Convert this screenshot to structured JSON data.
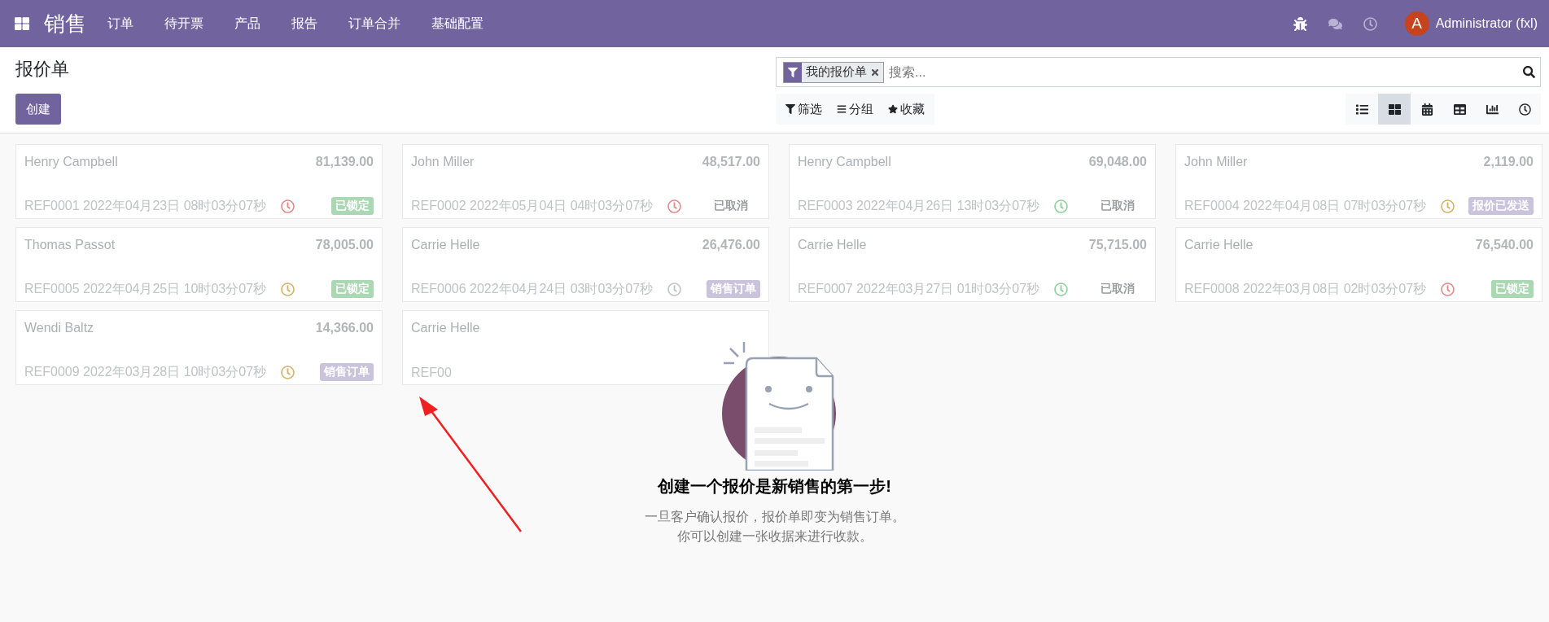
{
  "navbar": {
    "app_name": "销售",
    "menu": [
      "订单",
      "待开票",
      "产品",
      "报告",
      "订单合并",
      "基础配置"
    ],
    "user": {
      "initial": "A",
      "name": "Administrator (fxl)"
    }
  },
  "control_panel": {
    "title": "报价单",
    "create_button": "创建",
    "search": {
      "facet": "我的报价单",
      "placeholder": "搜索..."
    },
    "filters": [
      "筛选",
      "分组",
      "收藏"
    ],
    "views": [
      {
        "kind": "list",
        "selected": false
      },
      {
        "kind": "kanban",
        "selected": true
      },
      {
        "kind": "calendar",
        "selected": false
      },
      {
        "kind": "pivot",
        "selected": false
      },
      {
        "kind": "graph",
        "selected": false
      },
      {
        "kind": "activity",
        "selected": false
      }
    ]
  },
  "cards": [
    {
      "customer": "Henry Campbell",
      "amount": "81,139.00",
      "ref": "REF0001 2022年04月23日 08时03分07秒",
      "color": "#e08a8a",
      "status": {
        "label": "已锁定",
        "color": "#a9d8b3"
      }
    },
    {
      "customer": "John Miller",
      "amount": "48,517.00",
      "ref": "REF0002 2022年05月04日 04时03分07秒",
      "color": "#e08a8a",
      "status": {
        "label": "已取消"
      }
    },
    {
      "customer": "Henry Campbell",
      "amount": "69,048.00",
      "ref": "REF0003 2022年04月26日 13时03分07秒",
      "color": "#8fcf9c",
      "status": {
        "label": "已取消"
      }
    },
    {
      "customer": "John Miller",
      "amount": "2,119.00",
      "ref": "REF0004 2022年04月08日 07时03分07秒",
      "color": "#d4b26a",
      "status": {
        "label": "报价已发送",
        "color": "#c9c3dc"
      }
    },
    {
      "customer": "Thomas Passot",
      "amount": "78,005.00",
      "ref": "REF0005 2022年04月25日 10时03分07秒",
      "color": "#d4b26a",
      "status": {
        "label": "已锁定",
        "color": "#a9d8b3"
      }
    },
    {
      "customer": "Carrie Helle",
      "amount": "26,476.00",
      "ref": "REF0006 2022年04月24日 03时03分07秒",
      "color": "#c0c4c8",
      "status": {
        "label": "销售订单",
        "color": "#c9c3dc"
      }
    },
    {
      "customer": "Carrie Helle",
      "amount": "75,715.00",
      "ref": "REF0007 2022年03月27日 01时03分07秒",
      "color": "#8fcf9c",
      "status": {
        "label": "已取消"
      }
    },
    {
      "customer": "Carrie Helle",
      "amount": "76,540.00",
      "ref": "REF0008 2022年03月08日 02时03分07秒",
      "color": "#e08a8a",
      "status": {
        "label": "已锁定",
        "color": "#a9d8b3"
      }
    },
    {
      "customer": "Wendi Baltz",
      "amount": "14,366.00",
      "ref": "REF0009 2022年03月28日 10时03分07秒",
      "color": "#d4b26a",
      "status": {
        "label": "销售订单",
        "color": "#c9c3dc"
      }
    },
    {
      "customer": "Carrie Helle",
      "ref": "REF00"
    }
  ],
  "empty_state": {
    "title": "创建一个报价是新销售的第一步!",
    "lines": [
      "一旦客户确认报价，报价单即变为销售订单。",
      "你可以创建一张收据来进行收款。"
    ]
  }
}
